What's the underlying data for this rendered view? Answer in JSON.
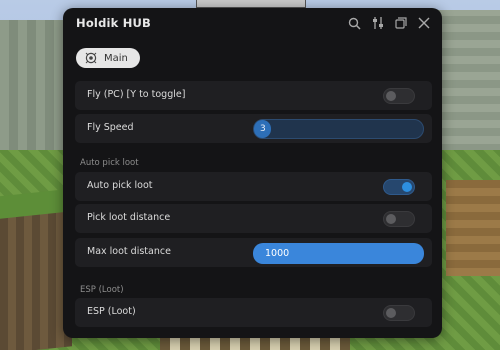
{
  "window": {
    "title": "Holdik HUB",
    "icons": [
      "search-icon",
      "settings-sliders-icon",
      "minimize-icon",
      "close-icon"
    ]
  },
  "tabs": [
    {
      "label": "Main",
      "icon": "main-tab-icon",
      "selected": true
    }
  ],
  "rows": {
    "fly": {
      "label": "Fly (PC) [Y to toggle]",
      "on": false
    },
    "fly_speed": {
      "label": "Fly Speed",
      "value": "3",
      "fraction": 0.1
    },
    "auto_pick_section": "Auto pick loot",
    "auto_pick": {
      "label": "Auto pick loot",
      "on": true
    },
    "pick_distance": {
      "label": "Pick loot distance",
      "on": false
    },
    "max_distance": {
      "label": "Max loot distance",
      "value": "1000"
    },
    "esp_section": "ESP (Loot)",
    "esp": {
      "label": "ESP (Loot)",
      "on": false
    }
  },
  "colors": {
    "panel_bg": "#141416",
    "row_bg": "#1f1f22",
    "accent": "#2d8fe0",
    "input_bg": "#3a86db"
  }
}
